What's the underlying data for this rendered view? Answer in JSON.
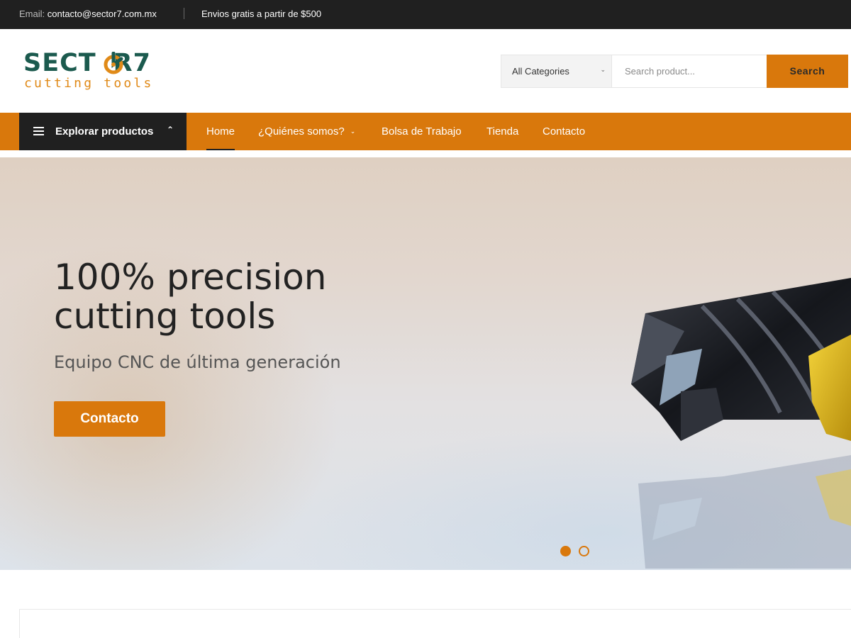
{
  "topbar": {
    "email_label": "Email:",
    "email": "contacto@sector7.com.mx",
    "shipping": "Envios gratis a partir de $500"
  },
  "logo": {
    "word": "SECT R7",
    "tagline": "cutting tools"
  },
  "search": {
    "category": "All Categories",
    "placeholder": "Search product...",
    "button": "Search"
  },
  "nav": {
    "explore": "Explorar productos",
    "items": [
      "Home",
      "¿Quiénes somos?",
      "Bolsa de Trabajo",
      "Tienda",
      "Contacto"
    ]
  },
  "hero": {
    "title": "100% precision cutting tools",
    "subtitle": "Equipo CNC de última generación",
    "cta": "Contacto"
  },
  "colors": {
    "accent": "#d9780c",
    "dark": "#202020",
    "brand_green": "#1b5a4e"
  },
  "icons": {
    "menu": "hamburger-icon",
    "chevron_up": "chevron-up-icon",
    "chevron_down": "chevron-down-icon"
  }
}
